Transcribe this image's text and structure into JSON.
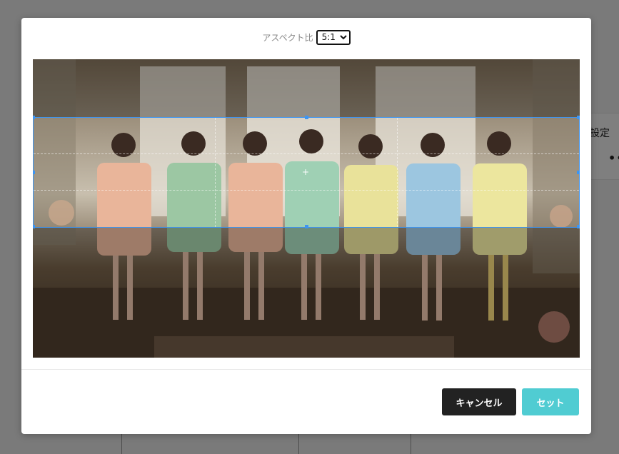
{
  "background": {
    "settings_label": "設定",
    "more_label": "••"
  },
  "dialog": {
    "aspect": {
      "label": "アスペクト比",
      "selected": "5:1",
      "options": [
        "5:1"
      ]
    },
    "buttons": {
      "cancel": "キャンセル",
      "set": "セット"
    }
  },
  "colors": {
    "crop_border": "#3d95f2",
    "cancel_bg": "#222222",
    "set_bg": "#50ccd2"
  }
}
